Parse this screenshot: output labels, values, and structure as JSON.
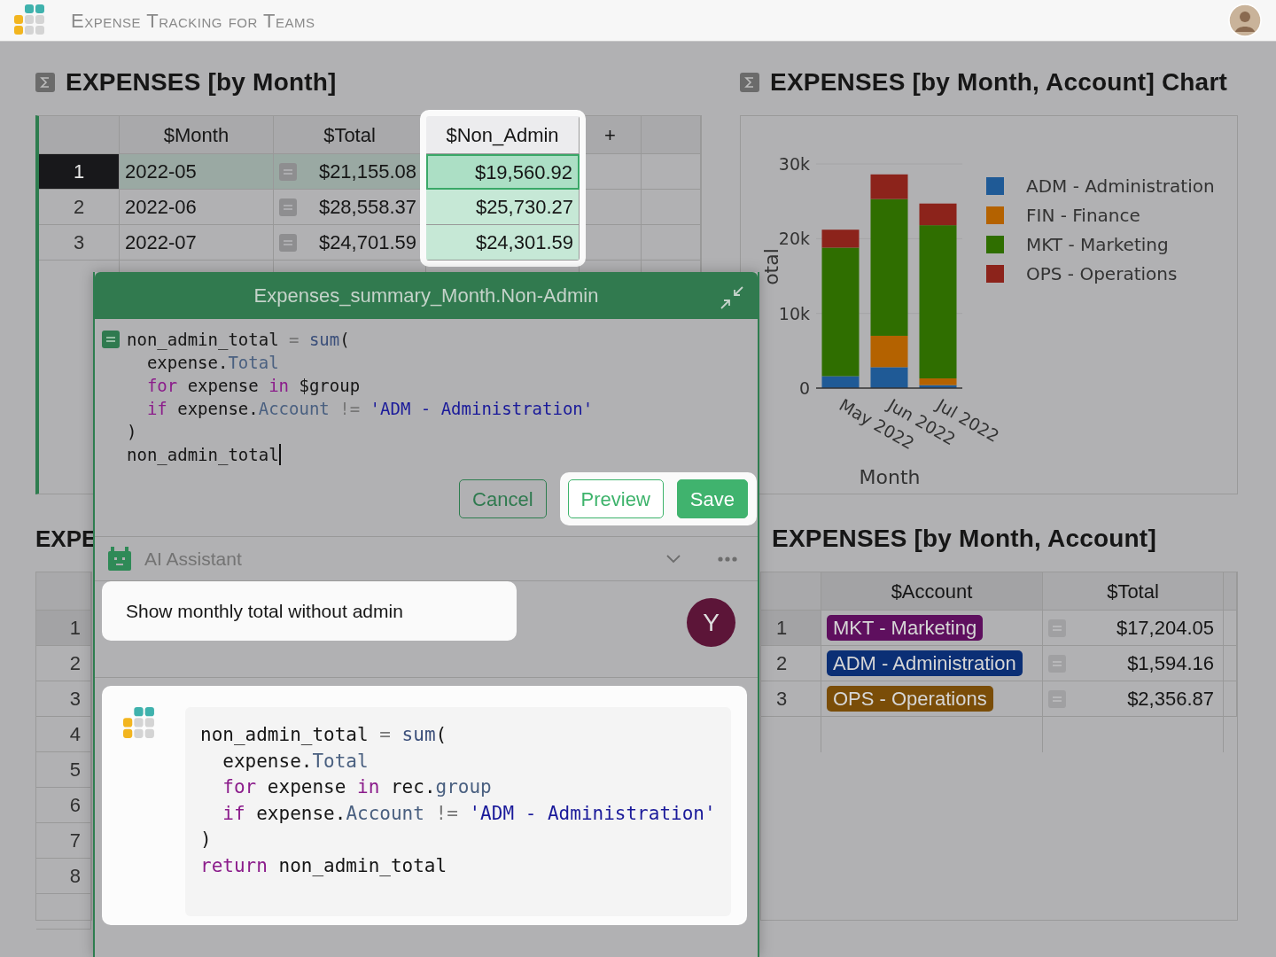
{
  "header": {
    "title": "Expense Tracking for Teams"
  },
  "month_table": {
    "title": "EXPENSES [by Month]",
    "columns": [
      {
        "label": "$Month",
        "spotlight": false
      },
      {
        "label": "$Total",
        "spotlight": false
      },
      {
        "label": "$Non_Admin",
        "spotlight": true
      },
      {
        "label": "+",
        "spotlight": false
      }
    ],
    "rows": [
      {
        "number": "1",
        "month": "2022-05",
        "total": "$21,155.08",
        "non_admin": "$19,560.92",
        "selected": true
      },
      {
        "number": "2",
        "month": "2022-06",
        "total": "$28,558.37",
        "non_admin": "$25,730.27",
        "selected": false
      },
      {
        "number": "3",
        "month": "2022-07",
        "total": "$24,701.59",
        "non_admin": "$24,301.59",
        "selected": false
      }
    ]
  },
  "chart_panel": {
    "title": "EXPENSES [by Month, Account] Chart",
    "chart_data": {
      "type": "bar",
      "stacked": true,
      "xlabel": "Month",
      "ylabel": "otal",
      "legend": "right",
      "categories": [
        "May 2022",
        "Jun 2022",
        "Jul 2022"
      ],
      "ylim": [
        0,
        30000
      ],
      "yticks": [
        {
          "value": 0,
          "label": "0"
        },
        {
          "value": 10000,
          "label": "10k"
        },
        {
          "value": 20000,
          "label": "20k"
        },
        {
          "value": 30000,
          "label": "30k"
        }
      ],
      "series": [
        {
          "name": "ADM - Administration",
          "color": "#1f5a96",
          "values": [
            1600,
            2800,
            400
          ]
        },
        {
          "name": "FIN - Finance",
          "color": "#b46200",
          "values": [
            0,
            4200,
            900
          ]
        },
        {
          "name": "MKT - Marketing",
          "color": "#2f6e00",
          "values": [
            17200,
            18300,
            20500
          ]
        },
        {
          "name": "OPS - Operations",
          "color": "#8c231b",
          "values": [
            2400,
            3300,
            2900
          ]
        }
      ]
    }
  },
  "partial_table": {
    "title": "EXPE",
    "rows": [
      {
        "number": "1",
        "selected": true
      },
      {
        "number": "2",
        "selected": false
      },
      {
        "number": "3",
        "selected": false
      },
      {
        "number": "4",
        "selected": false
      },
      {
        "number": "5",
        "selected": false
      },
      {
        "number": "6",
        "selected": false
      },
      {
        "number": "7",
        "selected": false
      },
      {
        "number": "8",
        "selected": false
      }
    ]
  },
  "account_table": {
    "title": "EXPENSES [by Month, Account]",
    "columns": [
      "$Account",
      "$Total"
    ],
    "rows": [
      {
        "number": "1",
        "account": "MKT - Marketing",
        "color": "#5e0f5e",
        "total": "$17,204.05",
        "selected": true
      },
      {
        "number": "2",
        "account": "ADM - Administration",
        "color": "#0b2f75",
        "total": "$1,594.16",
        "selected": false
      },
      {
        "number": "3",
        "account": "OPS - Operations",
        "color": "#7a4d08",
        "total": "$2,356.87",
        "selected": false
      }
    ]
  },
  "formula_editor": {
    "title": "Expenses_summary_Month.Non-Admin",
    "cursor": true,
    "code": [
      [
        {
          "text": "non_admin_total ",
          "kind": "plain"
        },
        {
          "text": "=",
          "kind": "op"
        },
        {
          "text": " sum",
          "kind": "func"
        },
        {
          "text": "(",
          "kind": "plain"
        }
      ],
      [
        {
          "text": "  expense.",
          "kind": "plain"
        },
        {
          "text": "Total",
          "kind": "attr"
        }
      ],
      [
        {
          "text": "  for",
          "kind": "keyword"
        },
        {
          "text": " expense ",
          "kind": "plain"
        },
        {
          "text": "in",
          "kind": "keyword"
        },
        {
          "text": " $group",
          "kind": "plain"
        }
      ],
      [
        {
          "text": "  if",
          "kind": "keyword"
        },
        {
          "text": " expense.",
          "kind": "plain"
        },
        {
          "text": "Account",
          "kind": "attr"
        },
        {
          "text": " !=",
          "kind": "op"
        },
        {
          "text": " 'ADM - Administration'",
          "kind": "string"
        }
      ],
      [
        {
          "text": ")",
          "kind": "plain"
        }
      ],
      [
        {
          "text": "non_admin_total",
          "kind": "plain"
        }
      ]
    ],
    "buttons": [
      {
        "label": "Cancel",
        "kind": "outline",
        "spotlight": false
      },
      {
        "label": "Preview",
        "kind": "outline",
        "spotlight": true
      },
      {
        "label": "Save",
        "kind": "primary",
        "spotlight": true
      }
    ]
  },
  "ai_assistant": {
    "title": "AI Assistant",
    "messages": [
      {
        "kind": "user",
        "text": "Show monthly total without admin",
        "avatar": "Y"
      },
      {
        "kind": "assistant",
        "code": [
          [
            {
              "text": "non_admin_total ",
              "kind": "plain"
            },
            {
              "text": "=",
              "kind": "op"
            },
            {
              "text": " sum",
              "kind": "func"
            },
            {
              "text": "(",
              "kind": "plain"
            }
          ],
          [
            {
              "text": "  expense.",
              "kind": "plain"
            },
            {
              "text": "Total",
              "kind": "attr"
            }
          ],
          [
            {
              "text": "  for",
              "kind": "keyword"
            },
            {
              "text": " expense ",
              "kind": "plain"
            },
            {
              "text": "in",
              "kind": "keyword"
            },
            {
              "text": " rec.",
              "kind": "plain"
            },
            {
              "text": "group",
              "kind": "attr"
            }
          ],
          [
            {
              "text": "  if",
              "kind": "keyword"
            },
            {
              "text": " expense.",
              "kind": "plain"
            },
            {
              "text": "Account",
              "kind": "attr"
            },
            {
              "text": " !=",
              "kind": "op"
            },
            {
              "text": " 'ADM - Administration'",
              "kind": "string"
            }
          ],
          [
            {
              "text": ")",
              "kind": "plain"
            }
          ],
          [
            {
              "text": "return",
              "kind": "keyword"
            },
            {
              "text": " non_admin_total",
              "kind": "plain"
            }
          ]
        ]
      }
    ]
  }
}
